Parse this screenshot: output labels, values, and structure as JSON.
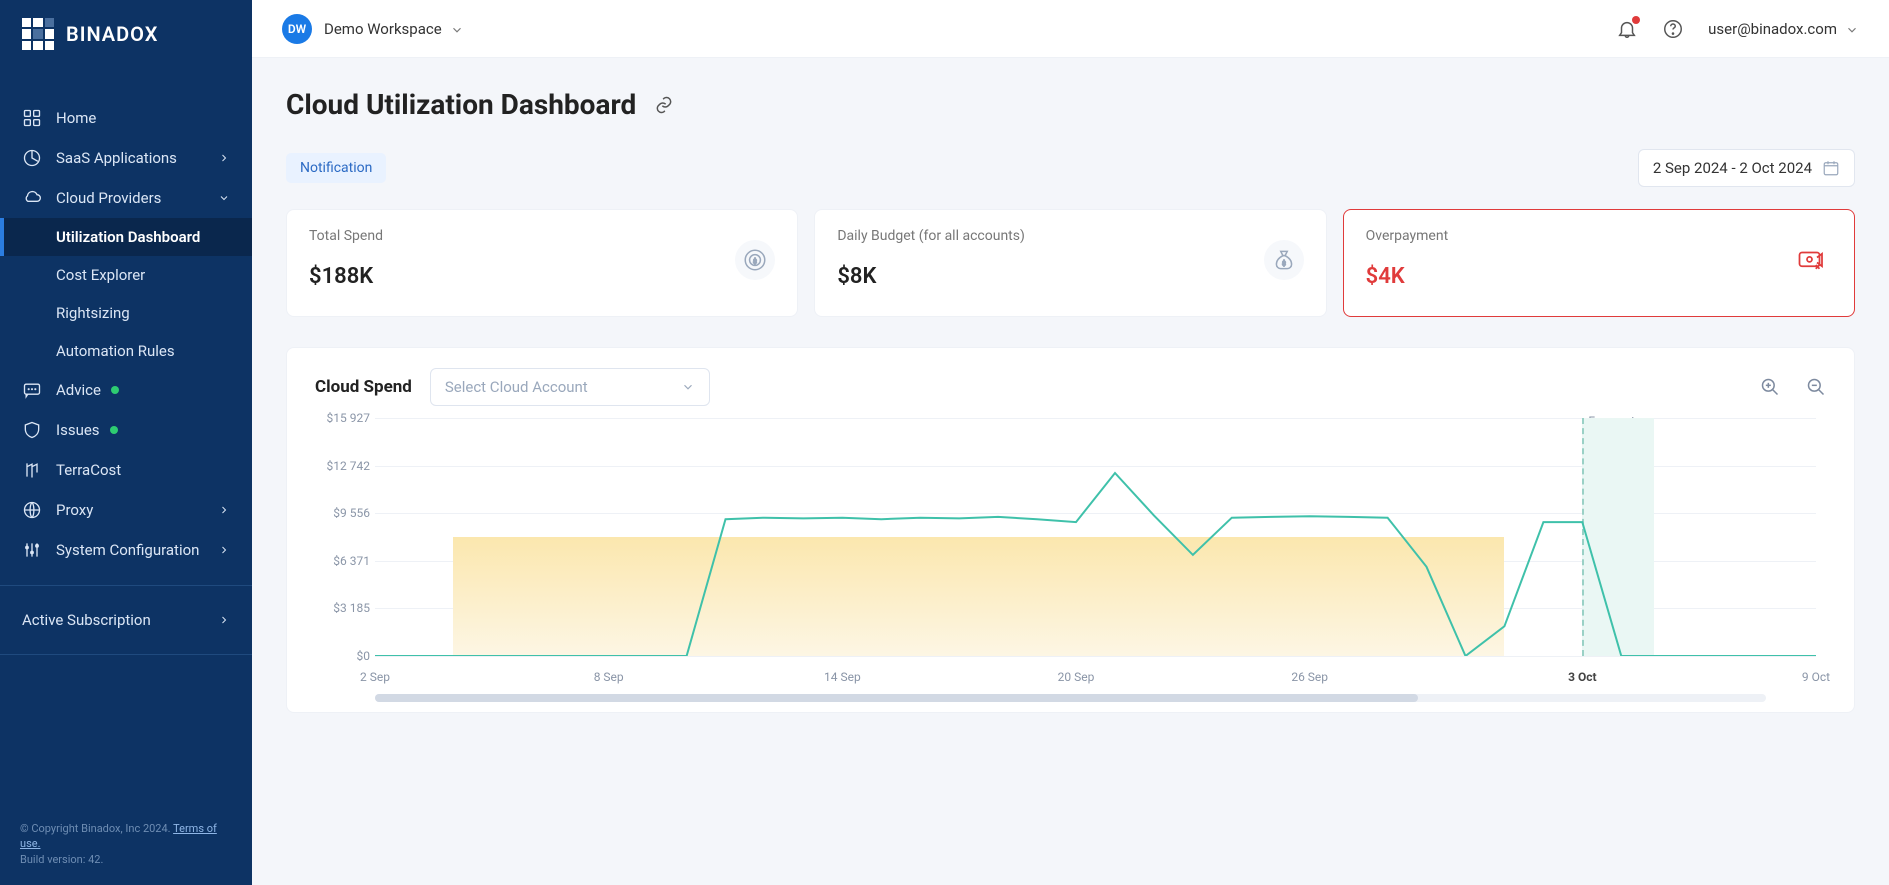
{
  "brand": {
    "name": "BINADOX"
  },
  "workspace": {
    "badge": "DW",
    "name": "Demo Workspace"
  },
  "user": {
    "email": "user@binadox.com"
  },
  "sidebar": {
    "home": "Home",
    "saas": "SaaS Applications",
    "cloud": "Cloud Providers",
    "cloud_items": {
      "utilization": "Utilization Dashboard",
      "cost_explorer": "Cost Explorer",
      "rightsizing": "Rightsizing",
      "automation": "Automation Rules"
    },
    "advice": "Advice",
    "issues": "Issues",
    "terracost": "TerraCost",
    "proxy": "Proxy",
    "system_config": "System Configuration",
    "subscription": "Active Subscription"
  },
  "footer": {
    "copyright": "© Copyright Binadox, Inc 2024. ",
    "terms": "Terms of use.",
    "build": "Build version: 42."
  },
  "page": {
    "title": "Cloud Utilization Dashboard"
  },
  "controls": {
    "notification": "Notification",
    "date_range": "2 Sep 2024 - 2 Oct 2024"
  },
  "cards": {
    "total_spend": {
      "label": "Total Spend",
      "value": "$188K"
    },
    "daily_budget": {
      "label": "Daily Budget (for all accounts)",
      "value": "$8K"
    },
    "overpayment": {
      "label": "Overpayment",
      "value": "$4K"
    }
  },
  "chart": {
    "title": "Cloud Spend",
    "select_placeholder": "Select Cloud Account",
    "forecast_label": "Forecast"
  },
  "chart_data": {
    "type": "line",
    "title": "Cloud Spend",
    "xlabel": "",
    "ylabel": "",
    "ylim": [
      0,
      16000
    ],
    "y_ticks": [
      "$0",
      "$3 185",
      "$6 371",
      "$9 556",
      "$12 742",
      "$15 927"
    ],
    "x_ticks": [
      "2 Sep",
      "8 Sep",
      "14 Sep",
      "20 Sep",
      "26 Sep",
      "3 Oct",
      "9 Oct"
    ],
    "x": [
      "2 Sep",
      "3 Sep",
      "4 Sep",
      "5 Sep",
      "6 Sep",
      "7 Sep",
      "8 Sep",
      "9 Sep",
      "10 Sep",
      "11 Sep",
      "12 Sep",
      "13 Sep",
      "14 Sep",
      "15 Sep",
      "16 Sep",
      "17 Sep",
      "18 Sep",
      "19 Sep",
      "20 Sep",
      "21 Sep",
      "22 Sep",
      "23 Sep",
      "24 Sep",
      "25 Sep",
      "26 Sep",
      "27 Sep",
      "28 Sep",
      "29 Sep",
      "30 Sep",
      "1 Oct",
      "2 Oct",
      "3 Oct",
      "4 Oct",
      "5 Oct",
      "6 Oct",
      "7 Oct",
      "8 Oct",
      "9 Oct"
    ],
    "values": [
      0,
      0,
      0,
      0,
      0,
      0,
      0,
      0,
      0,
      9200,
      9300,
      9250,
      9300,
      9200,
      9300,
      9250,
      9350,
      9200,
      9000,
      12300,
      9450,
      6800,
      9300,
      9350,
      9400,
      9350,
      9300,
      6000,
      0,
      2000,
      9000,
      9000,
      0,
      0,
      0,
      0,
      0,
      0
    ],
    "band": {
      "lower": 0,
      "upper": 8000,
      "x_start": "4 Sep",
      "x_end": "1 Oct"
    },
    "forecast_x": "3 Oct"
  }
}
